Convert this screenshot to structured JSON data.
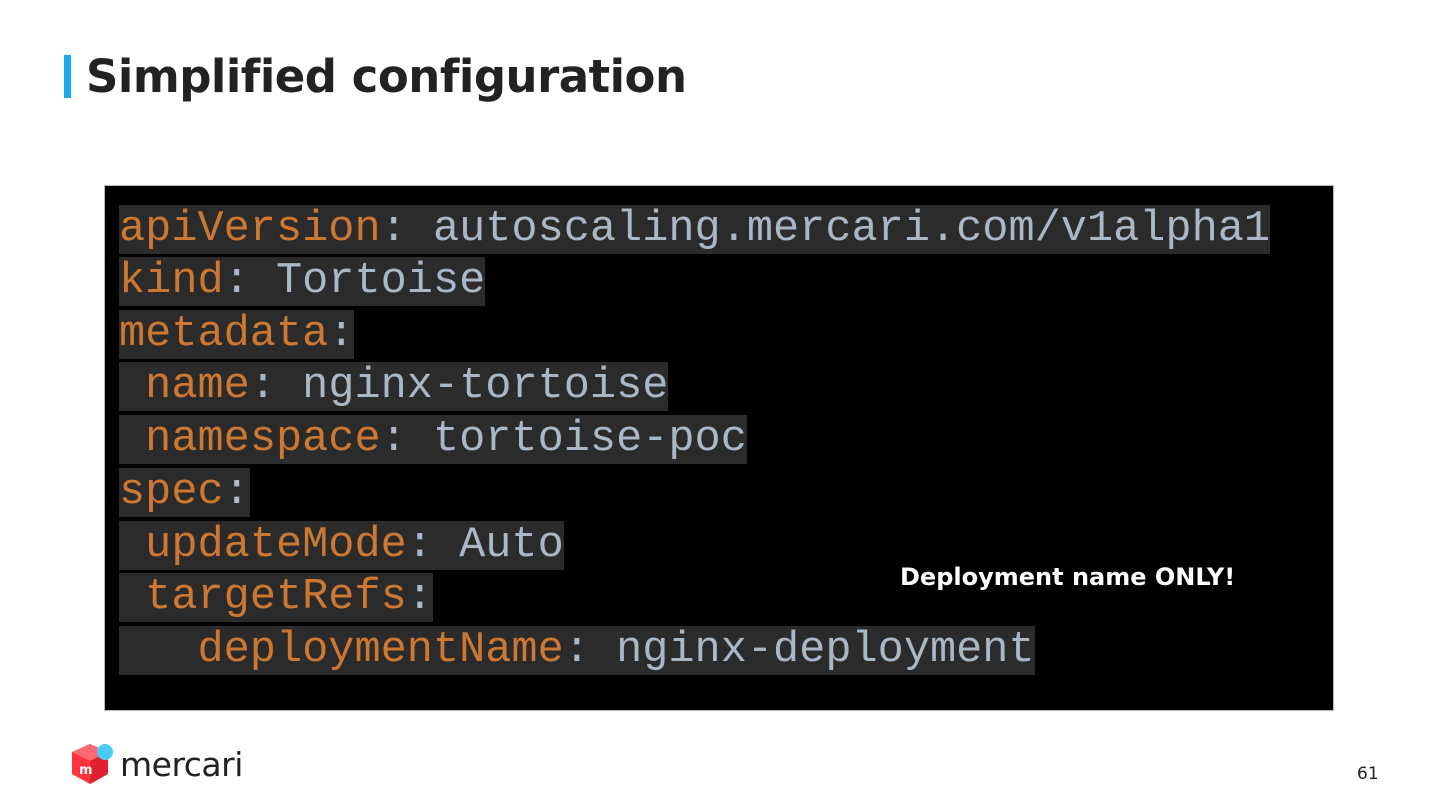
{
  "slide": {
    "title": "Simplified configuration",
    "note": "Deployment name ONLY!",
    "page_number": "61"
  },
  "code": {
    "lines": [
      {
        "indent": "",
        "key": "apiVersion",
        "sep": ": ",
        "value": "autoscaling.mercari.com/v1alpha1"
      },
      {
        "indent": "",
        "key": "kind",
        "sep": ": ",
        "value": "Tortoise"
      },
      {
        "indent": "",
        "key": "metadata",
        "sep": ":",
        "value": ""
      },
      {
        "indent": " ",
        "key": "name",
        "sep": ": ",
        "value": "nginx-tortoise"
      },
      {
        "indent": " ",
        "key": "namespace",
        "sep": ": ",
        "value": "tortoise-poc"
      },
      {
        "indent": "",
        "key": "spec",
        "sep": ":",
        "value": ""
      },
      {
        "indent": " ",
        "key": "updateMode",
        "sep": ": ",
        "value": "Auto"
      },
      {
        "indent": " ",
        "key": "targetRefs",
        "sep": ":",
        "value": ""
      },
      {
        "indent": "   ",
        "key": "deploymentName",
        "sep": ": ",
        "value": "nginx-deployment"
      }
    ]
  },
  "brand": {
    "name": "mercari",
    "logo_icon": "mercari-cube-icon",
    "accent_color": "#1ca8ef",
    "logo_red": "#ff333f"
  },
  "colors": {
    "code_background": "#000000",
    "line_highlight": "#2b2b2b",
    "yaml_key": "#cc7832",
    "yaml_value": "#a9b7c6"
  }
}
